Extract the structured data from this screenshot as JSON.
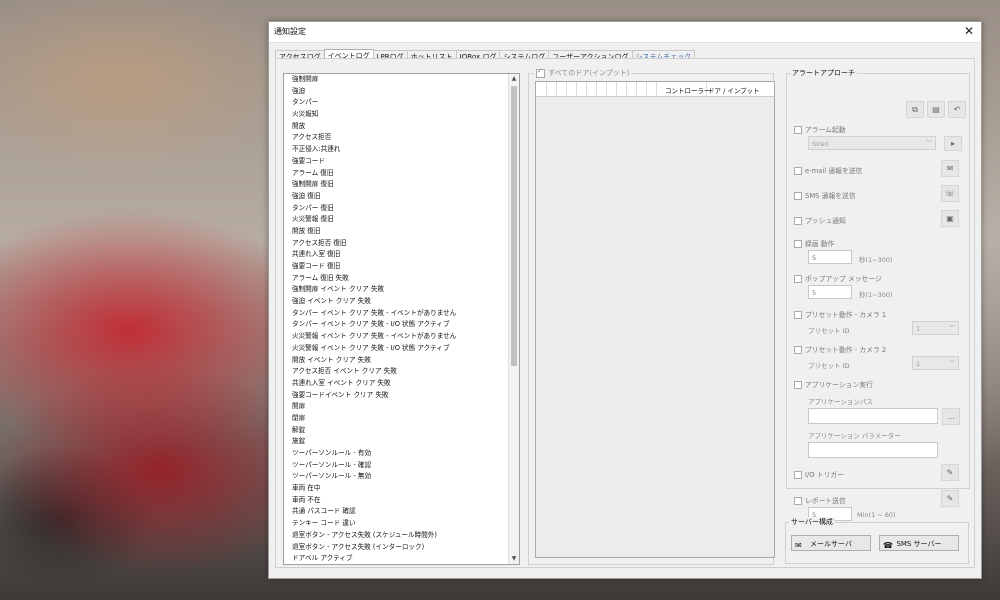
{
  "window": {
    "title": "通知設定",
    "close_glyph": "✕"
  },
  "tabs": [
    {
      "label": "アクセスログ"
    },
    {
      "label": "イベントログ"
    },
    {
      "label": "LPRログ"
    },
    {
      "label": "ホットリスト"
    },
    {
      "label": "IOBox ログ"
    },
    {
      "label": "システムログ"
    },
    {
      "label": "ユーザーアクションログ"
    },
    {
      "label": "システムチェック"
    }
  ],
  "event_list": {
    "items": [
      "強制開扉",
      "強迫",
      "タンパー",
      "火災報知",
      "開放",
      "アクセス拒否",
      "不正侵入:共連れ",
      "強要コード",
      "アラーム 復旧",
      "強制開扉 復旧",
      "強迫 復旧",
      "タンパー 復旧",
      "火災警報 復旧",
      "開放 復旧",
      "アクセス拒否 復旧",
      "共連れ入室 復旧",
      "強要コード 復旧",
      "アラーム 復旧 失敗",
      "強制開扉 イベント クリア 失敗",
      "強迫 イベント クリア 失敗",
      "タンパー イベント クリア 失敗 - イベントがありません",
      "タンパー イベント クリア 失敗 - I/O 状態 アクティブ",
      "火災警報 イベント クリア 失敗 - イベントがありません",
      "火災警報 イベント クリア 失敗 - I/O 状態 アクティブ",
      "開放 イベント クリア 失敗",
      "アクセス拒否 イベント クリア 失敗",
      "共連れ入室 イベント クリア 失敗",
      "強要コードイベント クリア 失敗",
      "開扉",
      "閉扉",
      "解錠",
      "施錠",
      "ツーパーソンルール - 有効",
      "ツーパーソンルール - 確認",
      "ツーパーソンルール - 無効",
      "車両 在中",
      "車両 不在",
      "共通 パスコード 確認",
      "テンキー コード 違い",
      "退室ボタン - アクセス失敗 (スケジュール時間外)",
      "退室ボタン - アクセス失敗 (インターロック)",
      "ドアベル アクティブ"
    ]
  },
  "doors": {
    "all_doors_label": "すべてのドア(インプット)",
    "all_doors_checked": true,
    "columns": [
      "コントローラー",
      "ドア / インプット"
    ]
  },
  "alert": {
    "group_label": "アラートアプローチ",
    "toolbar_icons": [
      "copy-icon",
      "paste-icon",
      "undo-icon"
    ],
    "alarm_start": {
      "label": "アラーム起動",
      "sound_value": "Siren",
      "play_glyph": "▸"
    },
    "email": {
      "label": "e-mail 通報を送信"
    },
    "sms": {
      "label": "SMS 通報を送信"
    },
    "push": {
      "label": "プッシュ通知"
    },
    "record": {
      "label": "録画 動作",
      "value": "5",
      "unit": "秒(1~300)"
    },
    "popup": {
      "label": "ポップアップ メッセージ",
      "value": "5",
      "unit": "秒(1~300)"
    },
    "preset1": {
      "label": "プリセット動作 - カメラ 1",
      "id_label": "プリセット ID",
      "id_value": "1"
    },
    "preset2": {
      "label": "プリセット動作 - カメラ 2",
      "id_label": "プリセット ID",
      "id_value": "1"
    },
    "app": {
      "label": "アプリケーション実行",
      "path_label": "アプリケーションパス",
      "browse": "...",
      "param_label": "アプリケーション パラメーター"
    },
    "io": {
      "label": "I/O トリガー"
    },
    "report": {
      "label": "レポート送信",
      "value": "5",
      "unit": "Min(1 ~ 60)"
    }
  },
  "server": {
    "group_label": "サーバー構成",
    "mail_button": "メールサーバ",
    "sms_button": "SMS サーバー"
  }
}
